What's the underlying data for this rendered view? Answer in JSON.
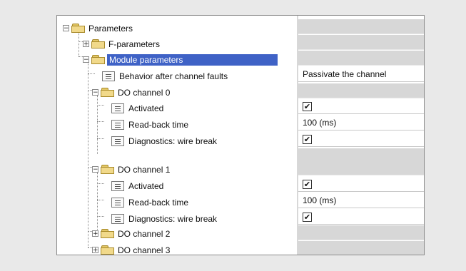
{
  "tree": {
    "root_label": "Parameters",
    "f_params_label": "F-parameters",
    "module_params_label": "Module parameters",
    "behavior_label": "Behavior after channel faults",
    "ch0_label": "DO channel 0",
    "ch0_activated_label": "Activated",
    "ch0_readback_label": "Read-back time",
    "ch0_diag_label": "Diagnostics: wire break",
    "ch1_label": "DO channel 1",
    "ch1_activated_label": "Activated",
    "ch1_readback_label": "Read-back time",
    "ch1_diag_label": "Diagnostics: wire break",
    "ch2_label": "DO channel 2",
    "ch3_label": "DO channel 3",
    "expanded_symbol": "−",
    "collapsed_symbol": "+"
  },
  "values": {
    "behavior": "Passivate the channel",
    "ch0_activated": "✔",
    "ch0_readback": "100 (ms)",
    "ch0_diag": "✔",
    "ch1_activated": "✔",
    "ch1_readback": "100 (ms)",
    "ch1_diag": "✔"
  },
  "colors": {
    "selection": "#3f62c6",
    "folder": "#f1d98a",
    "value_gray": "#d7d7d7"
  },
  "icons": [
    "folder-icon",
    "parameter-icon",
    "expander-icon",
    "checkbox-checked"
  ]
}
